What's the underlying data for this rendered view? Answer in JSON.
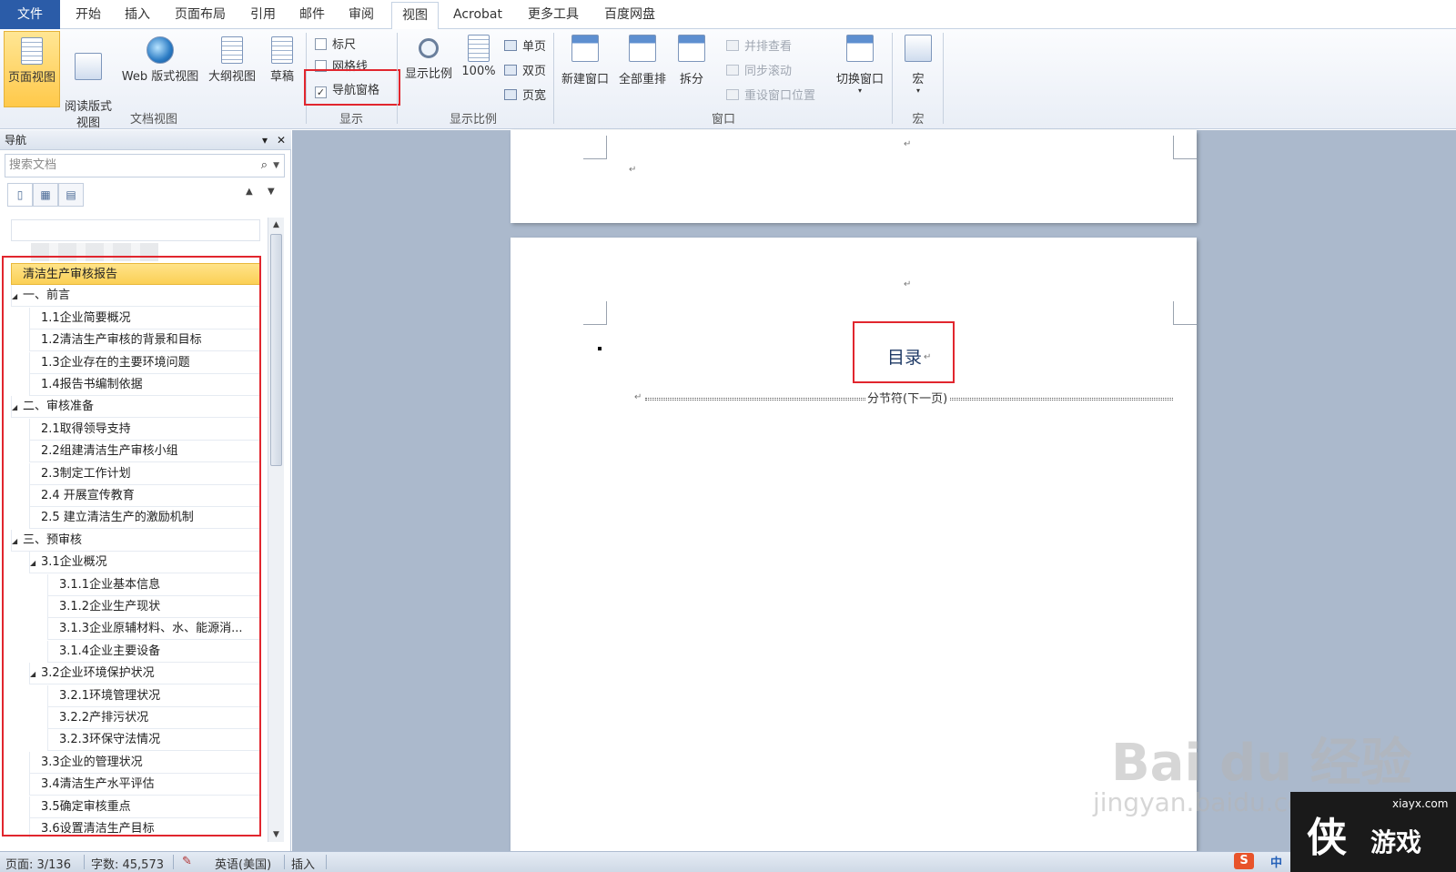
{
  "tabs": [
    "文件",
    "开始",
    "插入",
    "页面布局",
    "引用",
    "邮件",
    "审阅",
    "视图",
    "Acrobat",
    "更多工具",
    "百度网盘"
  ],
  "ribbon": {
    "doc_views": {
      "buttons": [
        "页面视图",
        "阅读版式\n视图",
        "Web 版式视图",
        "大纲视图",
        "草稿"
      ],
      "label": "文档视图"
    },
    "show": {
      "ruler": "标尺",
      "gridlines": "网格线",
      "nav_pane": "导航窗格",
      "nav_pane_checked": true,
      "label": "显示"
    },
    "zoom": {
      "zoom": "显示比例",
      "hundred": "100%",
      "one_page": "单页",
      "two_pages": "双页",
      "page_width": "页宽",
      "label": "显示比例"
    },
    "window": {
      "new_window": "新建窗口",
      "arrange_all": "全部重排",
      "split": "拆分",
      "side_by_side": "并排查看",
      "sync_scroll": "同步滚动",
      "reset_pos": "重设窗口位置",
      "switch_windows": "切换窗口",
      "label": "窗口"
    },
    "macros": {
      "macro": "宏",
      "label": "宏"
    }
  },
  "nav": {
    "title": "导航",
    "search_placeholder": "搜索文档",
    "items": [
      {
        "text": "清洁生产审核报告",
        "level": 0,
        "selected": true
      },
      {
        "text": "一、前言",
        "level": 0,
        "toggle": true
      },
      {
        "text": "1.1企业简要概况",
        "level": 1
      },
      {
        "text": "1.2清洁生产审核的背景和目标",
        "level": 1
      },
      {
        "text": "1.3企业存在的主要环境问题",
        "level": 1
      },
      {
        "text": "1.4报告书编制依据",
        "level": 1
      },
      {
        "text": "二、审核准备",
        "level": 0,
        "toggle": true
      },
      {
        "text": "2.1取得领导支持",
        "level": 1
      },
      {
        "text": "2.2组建清洁生产审核小组",
        "level": 1
      },
      {
        "text": "2.3制定工作计划",
        "level": 1
      },
      {
        "text": "2.4 开展宣传教育",
        "level": 1
      },
      {
        "text": "2.5 建立清洁生产的激励机制",
        "level": 1
      },
      {
        "text": "三、预审核",
        "level": 0,
        "toggle": true
      },
      {
        "text": "3.1企业概况",
        "level": 1,
        "toggle": true
      },
      {
        "text": "3.1.1企业基本信息",
        "level": 2
      },
      {
        "text": "3.1.2企业生产现状",
        "level": 2
      },
      {
        "text": "3.1.3企业原辅材料、水、能源消...",
        "level": 2
      },
      {
        "text": "3.1.4企业主要设备",
        "level": 2
      },
      {
        "text": "3.2企业环境保护状况",
        "level": 1,
        "toggle": true
      },
      {
        "text": "3.2.1环境管理状况",
        "level": 2
      },
      {
        "text": "3.2.2产排污状况",
        "level": 2
      },
      {
        "text": "3.2.3环保守法情况",
        "level": 2
      },
      {
        "text": "3.3企业的管理状况",
        "level": 1
      },
      {
        "text": "3.4清洁生产水平评估",
        "level": 1
      },
      {
        "text": "3.5确定审核重点",
        "level": 1
      },
      {
        "text": "3.6设置清洁生产目标",
        "level": 1
      }
    ]
  },
  "document": {
    "toc_title": "目录",
    "section_break": "分节符(下一页)"
  },
  "status": {
    "page": "页面: 3/136",
    "words": "字数: 45,573",
    "language": "英语(美国)",
    "mode": "插入"
  },
  "overlay": {
    "watermark_url": "jingyan.baidu.com",
    "site_url": "xiayx.com",
    "site_char": "侠",
    "site_word": "游戏",
    "ime": "中"
  }
}
